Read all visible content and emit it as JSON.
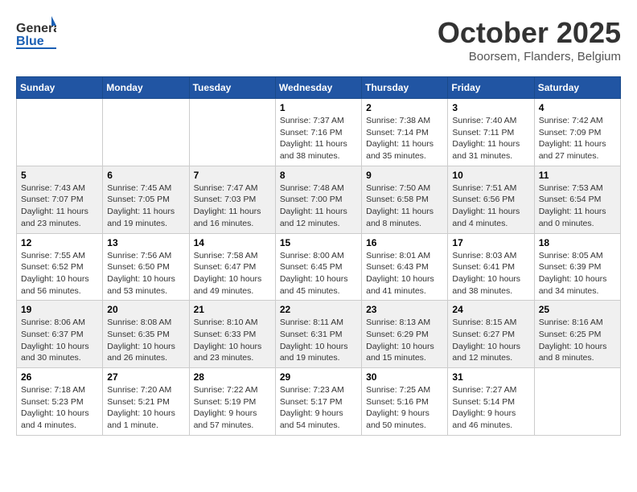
{
  "header": {
    "logo_general": "General",
    "logo_blue": "Blue",
    "month_title": "October 2025",
    "location": "Boorsem, Flanders, Belgium"
  },
  "weekdays": [
    "Sunday",
    "Monday",
    "Tuesday",
    "Wednesday",
    "Thursday",
    "Friday",
    "Saturday"
  ],
  "weeks": [
    [
      {
        "day": "",
        "info": ""
      },
      {
        "day": "",
        "info": ""
      },
      {
        "day": "",
        "info": ""
      },
      {
        "day": "1",
        "info": "Sunrise: 7:37 AM\nSunset: 7:16 PM\nDaylight: 11 hours\nand 38 minutes."
      },
      {
        "day": "2",
        "info": "Sunrise: 7:38 AM\nSunset: 7:14 PM\nDaylight: 11 hours\nand 35 minutes."
      },
      {
        "day": "3",
        "info": "Sunrise: 7:40 AM\nSunset: 7:11 PM\nDaylight: 11 hours\nand 31 minutes."
      },
      {
        "day": "4",
        "info": "Sunrise: 7:42 AM\nSunset: 7:09 PM\nDaylight: 11 hours\nand 27 minutes."
      }
    ],
    [
      {
        "day": "5",
        "info": "Sunrise: 7:43 AM\nSunset: 7:07 PM\nDaylight: 11 hours\nand 23 minutes."
      },
      {
        "day": "6",
        "info": "Sunrise: 7:45 AM\nSunset: 7:05 PM\nDaylight: 11 hours\nand 19 minutes."
      },
      {
        "day": "7",
        "info": "Sunrise: 7:47 AM\nSunset: 7:03 PM\nDaylight: 11 hours\nand 16 minutes."
      },
      {
        "day": "8",
        "info": "Sunrise: 7:48 AM\nSunset: 7:00 PM\nDaylight: 11 hours\nand 12 minutes."
      },
      {
        "day": "9",
        "info": "Sunrise: 7:50 AM\nSunset: 6:58 PM\nDaylight: 11 hours\nand 8 minutes."
      },
      {
        "day": "10",
        "info": "Sunrise: 7:51 AM\nSunset: 6:56 PM\nDaylight: 11 hours\nand 4 minutes."
      },
      {
        "day": "11",
        "info": "Sunrise: 7:53 AM\nSunset: 6:54 PM\nDaylight: 11 hours\nand 0 minutes."
      }
    ],
    [
      {
        "day": "12",
        "info": "Sunrise: 7:55 AM\nSunset: 6:52 PM\nDaylight: 10 hours\nand 56 minutes."
      },
      {
        "day": "13",
        "info": "Sunrise: 7:56 AM\nSunset: 6:50 PM\nDaylight: 10 hours\nand 53 minutes."
      },
      {
        "day": "14",
        "info": "Sunrise: 7:58 AM\nSunset: 6:47 PM\nDaylight: 10 hours\nand 49 minutes."
      },
      {
        "day": "15",
        "info": "Sunrise: 8:00 AM\nSunset: 6:45 PM\nDaylight: 10 hours\nand 45 minutes."
      },
      {
        "day": "16",
        "info": "Sunrise: 8:01 AM\nSunset: 6:43 PM\nDaylight: 10 hours\nand 41 minutes."
      },
      {
        "day": "17",
        "info": "Sunrise: 8:03 AM\nSunset: 6:41 PM\nDaylight: 10 hours\nand 38 minutes."
      },
      {
        "day": "18",
        "info": "Sunrise: 8:05 AM\nSunset: 6:39 PM\nDaylight: 10 hours\nand 34 minutes."
      }
    ],
    [
      {
        "day": "19",
        "info": "Sunrise: 8:06 AM\nSunset: 6:37 PM\nDaylight: 10 hours\nand 30 minutes."
      },
      {
        "day": "20",
        "info": "Sunrise: 8:08 AM\nSunset: 6:35 PM\nDaylight: 10 hours\nand 26 minutes."
      },
      {
        "day": "21",
        "info": "Sunrise: 8:10 AM\nSunset: 6:33 PM\nDaylight: 10 hours\nand 23 minutes."
      },
      {
        "day": "22",
        "info": "Sunrise: 8:11 AM\nSunset: 6:31 PM\nDaylight: 10 hours\nand 19 minutes."
      },
      {
        "day": "23",
        "info": "Sunrise: 8:13 AM\nSunset: 6:29 PM\nDaylight: 10 hours\nand 15 minutes."
      },
      {
        "day": "24",
        "info": "Sunrise: 8:15 AM\nSunset: 6:27 PM\nDaylight: 10 hours\nand 12 minutes."
      },
      {
        "day": "25",
        "info": "Sunrise: 8:16 AM\nSunset: 6:25 PM\nDaylight: 10 hours\nand 8 minutes."
      }
    ],
    [
      {
        "day": "26",
        "info": "Sunrise: 7:18 AM\nSunset: 5:23 PM\nDaylight: 10 hours\nand 4 minutes."
      },
      {
        "day": "27",
        "info": "Sunrise: 7:20 AM\nSunset: 5:21 PM\nDaylight: 10 hours\nand 1 minute."
      },
      {
        "day": "28",
        "info": "Sunrise: 7:22 AM\nSunset: 5:19 PM\nDaylight: 9 hours\nand 57 minutes."
      },
      {
        "day": "29",
        "info": "Sunrise: 7:23 AM\nSunset: 5:17 PM\nDaylight: 9 hours\nand 54 minutes."
      },
      {
        "day": "30",
        "info": "Sunrise: 7:25 AM\nSunset: 5:16 PM\nDaylight: 9 hours\nand 50 minutes."
      },
      {
        "day": "31",
        "info": "Sunrise: 7:27 AM\nSunset: 5:14 PM\nDaylight: 9 hours\nand 46 minutes."
      },
      {
        "day": "",
        "info": ""
      }
    ]
  ]
}
